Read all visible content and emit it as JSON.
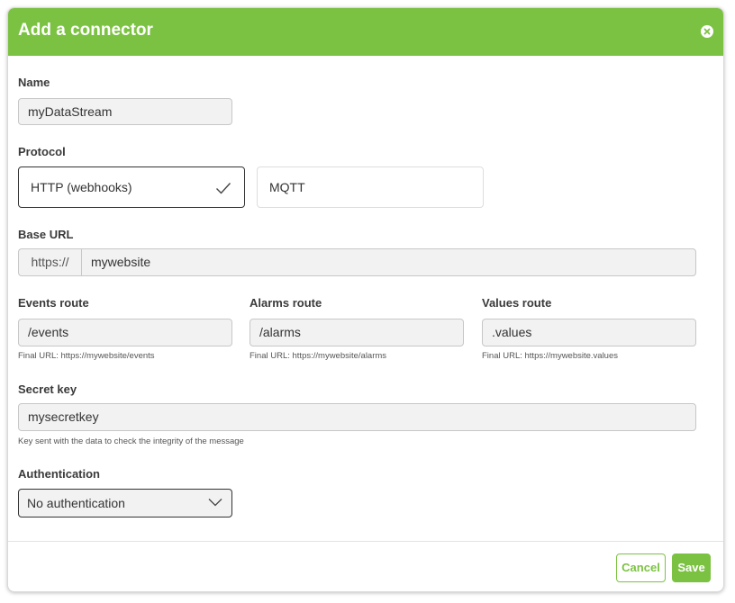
{
  "modal": {
    "title": "Add a connector",
    "close_icon": "close-icon"
  },
  "name": {
    "label": "Name",
    "value": "myDataStream"
  },
  "protocol": {
    "label": "Protocol",
    "options": [
      {
        "label": "HTTP (webhooks)",
        "selected": true
      },
      {
        "label": "MQTT",
        "selected": false
      }
    ]
  },
  "base_url": {
    "label": "Base URL",
    "prefix": "https://",
    "value": "mywebsite"
  },
  "routes": [
    {
      "label": "Events route",
      "value": "/events",
      "hint": "Final URL: https://mywebsite/events"
    },
    {
      "label": "Alarms route",
      "value": "/alarms",
      "hint": "Final URL: https://mywebsite/alarms"
    },
    {
      "label": "Values route",
      "value": ".values",
      "hint": "Final URL: https://mywebsite.values"
    }
  ],
  "secret": {
    "label": "Secret key",
    "value": "mysecretkey",
    "hint": "Key sent with the data to check the integrity of the message"
  },
  "auth": {
    "label": "Authentication",
    "selected": "No authentication"
  },
  "footer": {
    "cancel_label": "Cancel",
    "save_label": "Save"
  },
  "colors": {
    "accent": "#7cc242",
    "field_bg": "#f2f2f2",
    "border": "#c7c7c7"
  }
}
